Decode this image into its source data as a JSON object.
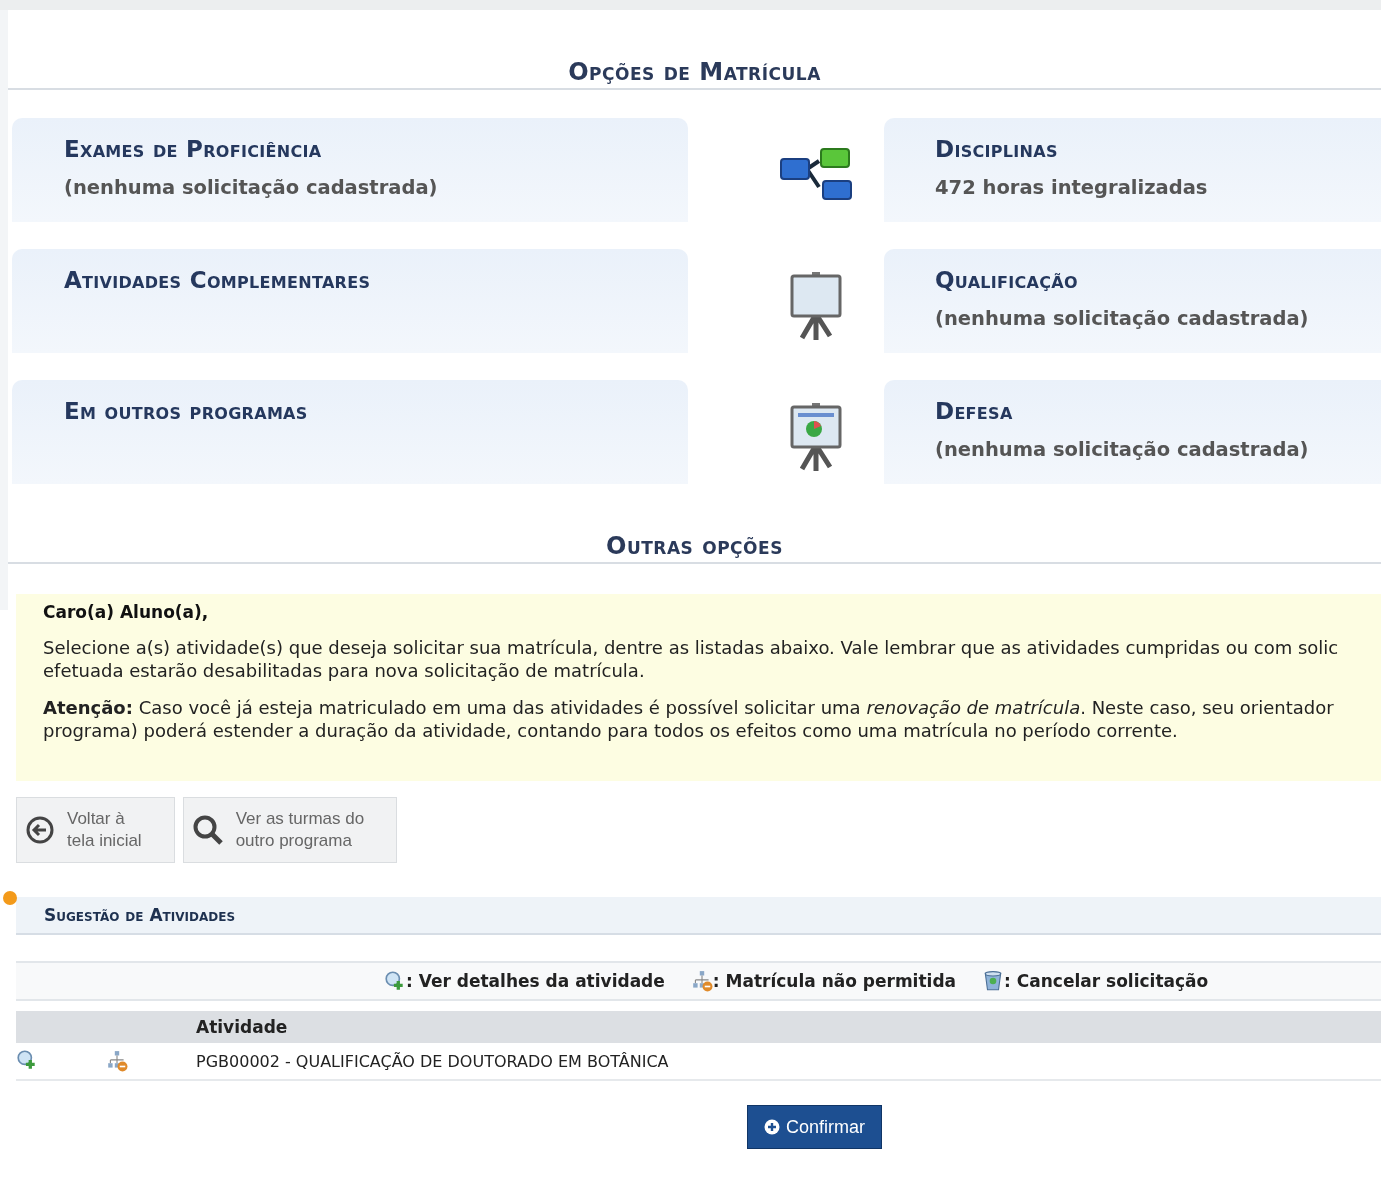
{
  "enrollment_options": {
    "title": "Opções de Matrícula",
    "rows": [
      {
        "left": {
          "title": "Exames de Proficiência",
          "subtitle": "(nenhuma solicitação cadastrada)"
        },
        "right": {
          "kind": "tree",
          "title": "Disciplinas",
          "subtitle": "472 horas integralizadas"
        }
      },
      {
        "left": {
          "title": "Atividades Complementares"
        },
        "right": {
          "kind": "board",
          "title": "Qualificação",
          "subtitle": "(nenhuma solicitação cadastrada)"
        }
      },
      {
        "left": {
          "title": "Em outros programas"
        },
        "right": {
          "kind": "chart-board",
          "title": "Defesa",
          "subtitle": "(nenhuma solicitação cadastrada)"
        }
      }
    ]
  },
  "other_options": {
    "title": "Outras opções"
  },
  "notice": {
    "greeting": "Caro(a) Aluno(a),",
    "paragraphs": [
      "Selecione a(s) atividade(s) que deseja solicitar sua matrícula, dentre as listadas abaixo. Vale lembrar que as atividades cumpridas ou com solic\nefetuada estarão desabilitadas para nova solicitação de matrícula.",
      "**Atenção:** Caso você já esteja matriculado em uma das atividades é possível solicitar uma *renovação de matrícula*. Neste caso, seu orientador\nprograma) poderá estender a duração da atividade, contando para todos os efeitos como uma matrícula no período corrente."
    ]
  },
  "actions": [
    {
      "kind": "back",
      "label": "Voltar à\ntela inicial"
    },
    {
      "kind": "search",
      "label": "Ver as turmas do\noutro programa"
    }
  ],
  "suggestions": {
    "title": "Sugestão de Atividades",
    "legend": [
      {
        "kind": "details",
        "label": ": Ver detalhes da atividade"
      },
      {
        "kind": "blocked",
        "label": ": Matrícula não permitida"
      },
      {
        "kind": "cancel",
        "label": ": Cancelar solicitação"
      }
    ],
    "columns": [
      "Atividade"
    ],
    "rows": [
      {
        "enrollment_allowed": false,
        "activity": "PGB00002 - QUALIFICAÇÃO DE DOUTORADO EM BOTÂNICA"
      }
    ],
    "confirm_button": "Confirmar"
  }
}
